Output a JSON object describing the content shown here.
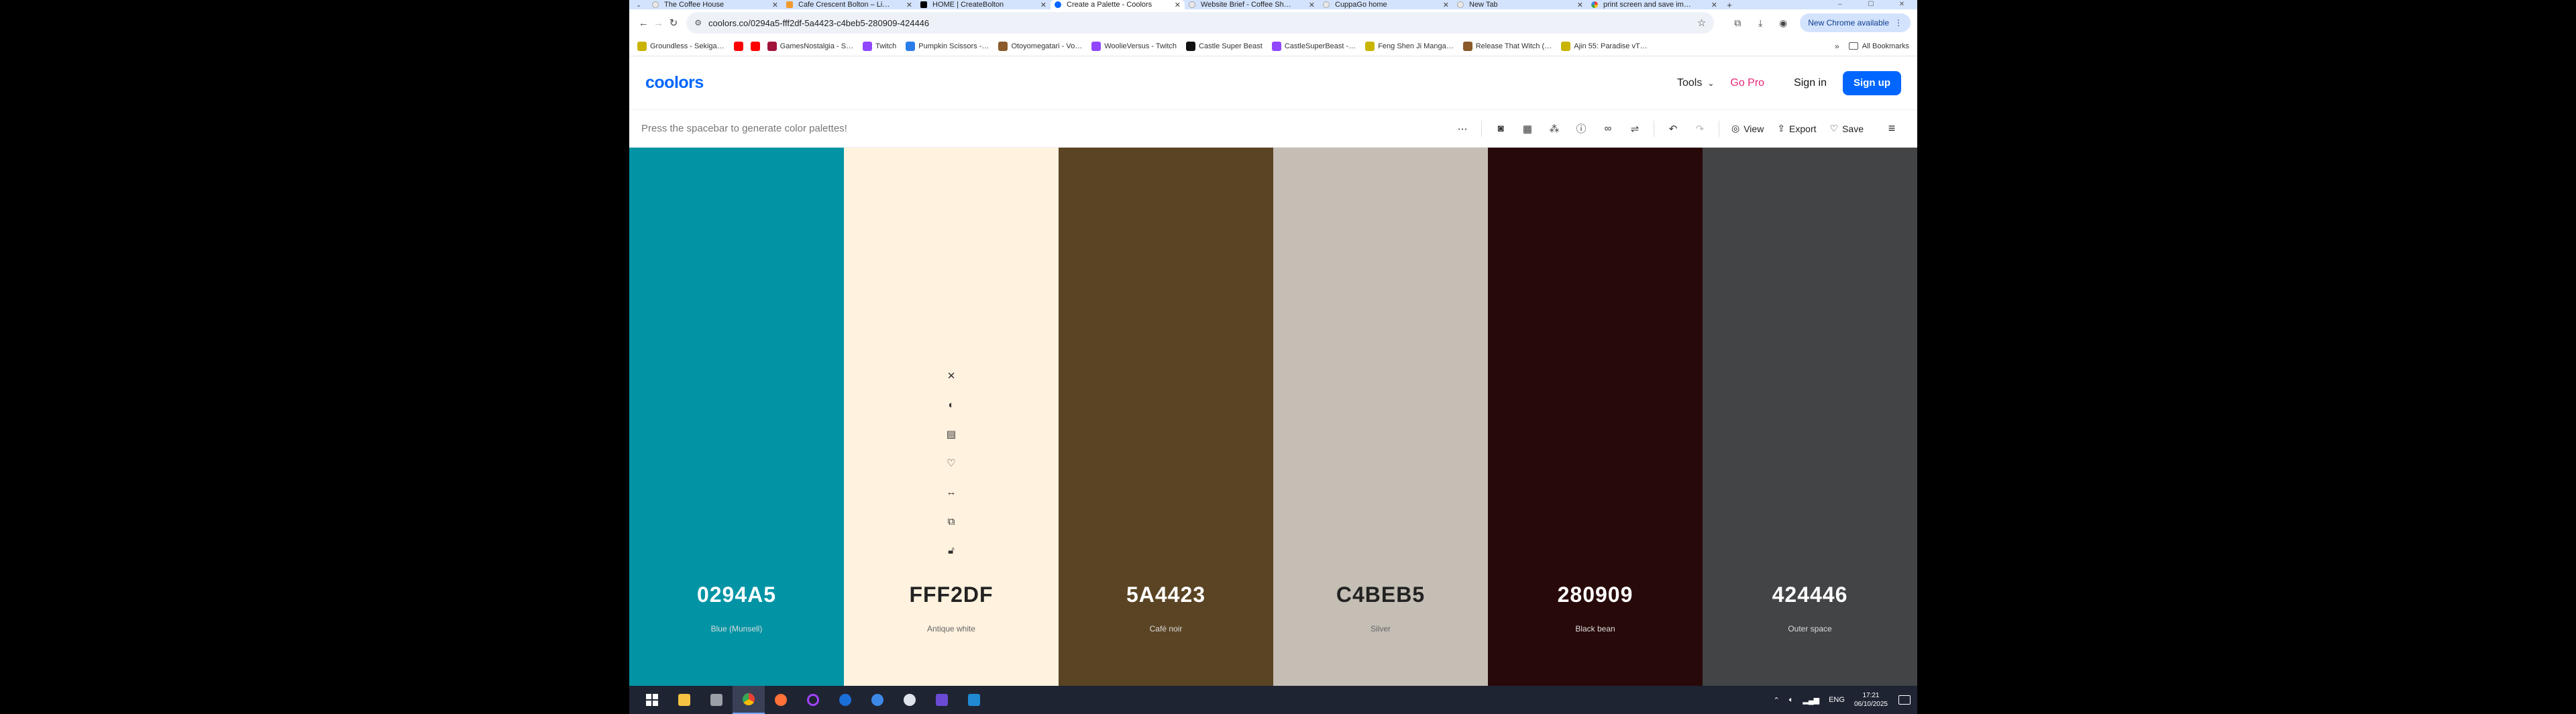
{
  "browser": {
    "tabs": [
      {
        "title": "The Coffee House",
        "favicon": "gg",
        "active": false
      },
      {
        "title": "Cafe Crescent Bolton – Li…",
        "favicon": "cb",
        "active": false
      },
      {
        "title": "HOME | CreateBolton",
        "favicon": "wix",
        "active": false
      },
      {
        "title": "Create a Palette - Coolors",
        "favicon": "coolors",
        "active": true
      },
      {
        "title": "Website Brief - Coffee Sh…",
        "favicon": "gg",
        "active": false
      },
      {
        "title": "CuppaGo home",
        "favicon": "gg",
        "active": false
      },
      {
        "title": "New Tab",
        "favicon": "gg",
        "active": false
      },
      {
        "title": "print screen and save im…",
        "favicon": "ggl",
        "active": false
      }
    ],
    "new_tab": "+",
    "url": "coolors.co/0294a5-fff2df-5a4423-c4beb5-280909-424446",
    "update_label": "New Chrome available",
    "bookmarks": [
      {
        "label": "Groundless - Sekiga…",
        "color": "#c9b400"
      },
      {
        "label": "",
        "color": "#ff0000"
      },
      {
        "label": "",
        "color": "#ff0000"
      },
      {
        "label": "GamesNostalgia - S…",
        "color": "#a0143c"
      },
      {
        "label": "Twitch",
        "color": "#9146ff"
      },
      {
        "label": "Pumpkin Scissors -…",
        "color": "#2b7de9"
      },
      {
        "label": "Otoyomegatari - Vo…",
        "color": "#8a5a2b"
      },
      {
        "label": "WoolieVersus - Twitch",
        "color": "#9146ff"
      },
      {
        "label": "Castle Super Beast",
        "color": "#111111"
      },
      {
        "label": "CastleSuperBeast -…",
        "color": "#9146ff"
      },
      {
        "label": "Feng Shen Ji Manga…",
        "color": "#c9b400"
      },
      {
        "label": "Release That Witch (…",
        "color": "#8a5a2b"
      },
      {
        "label": "Ajin 55: Paradise vT…",
        "color": "#c9b400"
      }
    ],
    "all_bookmarks": "All Bookmarks"
  },
  "site": {
    "logo": "coolors",
    "tools_label": "Tools",
    "gopro_label": "Go Pro",
    "signin_label": "Sign in",
    "signup_label": "Sign up"
  },
  "palette_bar": {
    "hint": "Press the spacebar to generate color palettes!",
    "view_label": "View",
    "export_label": "Export",
    "save_label": "Save"
  },
  "palette": [
    {
      "hex": "0294A5",
      "name": "Blue (Munsell)",
      "color": "#0294A5",
      "tone": "dark"
    },
    {
      "hex": "FFF2DF",
      "name": "Antique white",
      "color": "#FFF2DF",
      "tone": "light"
    },
    {
      "hex": "5A4423",
      "name": "Café noir",
      "color": "#5A4423",
      "tone": "dark"
    },
    {
      "hex": "C4BEB5",
      "name": "Silver",
      "color": "#C4BEB5",
      "tone": "light"
    },
    {
      "hex": "280909",
      "name": "Black bean",
      "color": "#280909",
      "tone": "dark"
    },
    {
      "hex": "424446",
      "name": "Outer space",
      "color": "#424446",
      "tone": "dark"
    }
  ],
  "taskbar": {
    "language": "ENG",
    "time": "17:21",
    "date": "06/10/2025"
  }
}
